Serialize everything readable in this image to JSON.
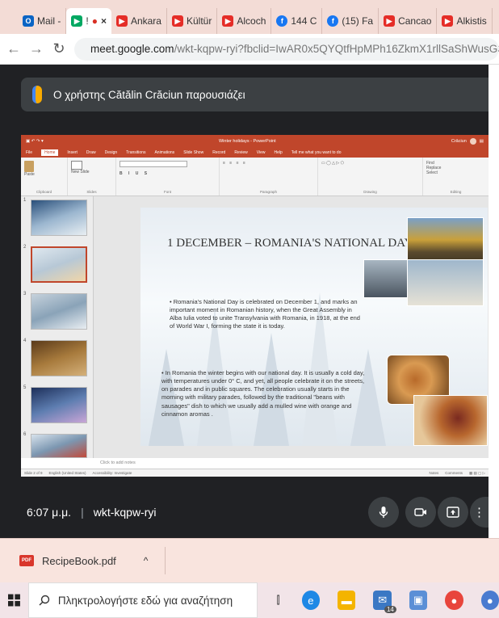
{
  "browser": {
    "tabs": [
      {
        "label": "Mail -",
        "icon": "outlook-icon",
        "color": "#0a64c4"
      },
      {
        "label": "!",
        "icon": "meet-icon",
        "color": "#00a862",
        "active": true,
        "close": "×",
        "record": "●"
      },
      {
        "label": "Ankara",
        "icon": "youtube-icon",
        "color": "#e52d27"
      },
      {
        "label": "Kültür",
        "icon": "youtube-icon",
        "color": "#e52d27"
      },
      {
        "label": "Alcoch",
        "icon": "youtube-icon",
        "color": "#e52d27"
      },
      {
        "label": "144 C",
        "icon": "facebook-icon",
        "color": "#1877f2"
      },
      {
        "label": "(15) Fa",
        "icon": "facebook-icon",
        "color": "#1877f2"
      },
      {
        "label": "Cancao",
        "icon": "youtube-icon",
        "color": "#e52d27"
      },
      {
        "label": "Alkistis",
        "icon": "youtube-icon",
        "color": "#e52d27"
      }
    ],
    "url_host": "meet.google.com",
    "url_path": "/wkt-kqpw-ryi?fbclid=IwAR0x5QYQtfHpMPh16ZkmX1rllSaShWusG3UiKvfYFNJ"
  },
  "meet": {
    "presenting_banner": "Ο χρήστης Cătălin Crăciun παρουσιάζει",
    "time": "6:07 μ.μ.",
    "meeting_code": "wkt-kqpw-ryi"
  },
  "powerpoint": {
    "title": "Winter holidays - PowerPoint",
    "user": "Crăciun",
    "tabs": [
      "File",
      "Home",
      "Insert",
      "Draw",
      "Design",
      "Transitions",
      "Animations",
      "Slide Show",
      "Record",
      "Review",
      "View",
      "Help",
      "Tell me what you want to do"
    ],
    "groups": [
      "Clipboard",
      "Slides",
      "Font",
      "Paragraph",
      "Drawing",
      "Editing"
    ],
    "ribbon_labels": {
      "paste": "Paste",
      "new_slide": "New Slide",
      "find": "Find",
      "replace": "Replace",
      "select": "Select"
    },
    "notes_placeholder": "Click to add notes",
    "status_left": "Slide 2 of 9",
    "status_lang": "English (United States)",
    "status_access": "Accessibility: Investigate",
    "status_notes": "Notes",
    "status_comments": "Comments"
  },
  "slide": {
    "title": "1 DECEMBER – ROMANIA'S NATIONAL DAY",
    "bullet1": "Romania's National Day is celebrated on December 1, and marks an important moment in Romanian history, when the Great Assembly in Alba Iulia voted to unite Transylvania with Romania, in 1918, at the end of World War I, forming the state it is today.",
    "bullet2": "In Romania the winter begins with our national day. It is usually a cold day, with temperatures under 0° C, and yet, all people celebrate it on the streets, on parades and in public squares. The celebration usually starts in the morning with military parades, followed by the traditional \"beans with sausages\" dish to which we usually add a mulled wine with orange and cinnamon aromas ."
  },
  "thumbs": [
    "1",
    "2",
    "3",
    "4",
    "5",
    "6"
  ],
  "downloads": {
    "file": "RecipeBook.pdf",
    "badge": "PDF",
    "chevron": "^"
  },
  "taskbar": {
    "search_placeholder": "Πληκτρολογήστε εδώ για αναζήτηση",
    "badge": "14"
  },
  "colors": {
    "ppt_accent": "#c0462b",
    "meet_bg": "#202124",
    "tabstrip": "#f3dcd6"
  }
}
